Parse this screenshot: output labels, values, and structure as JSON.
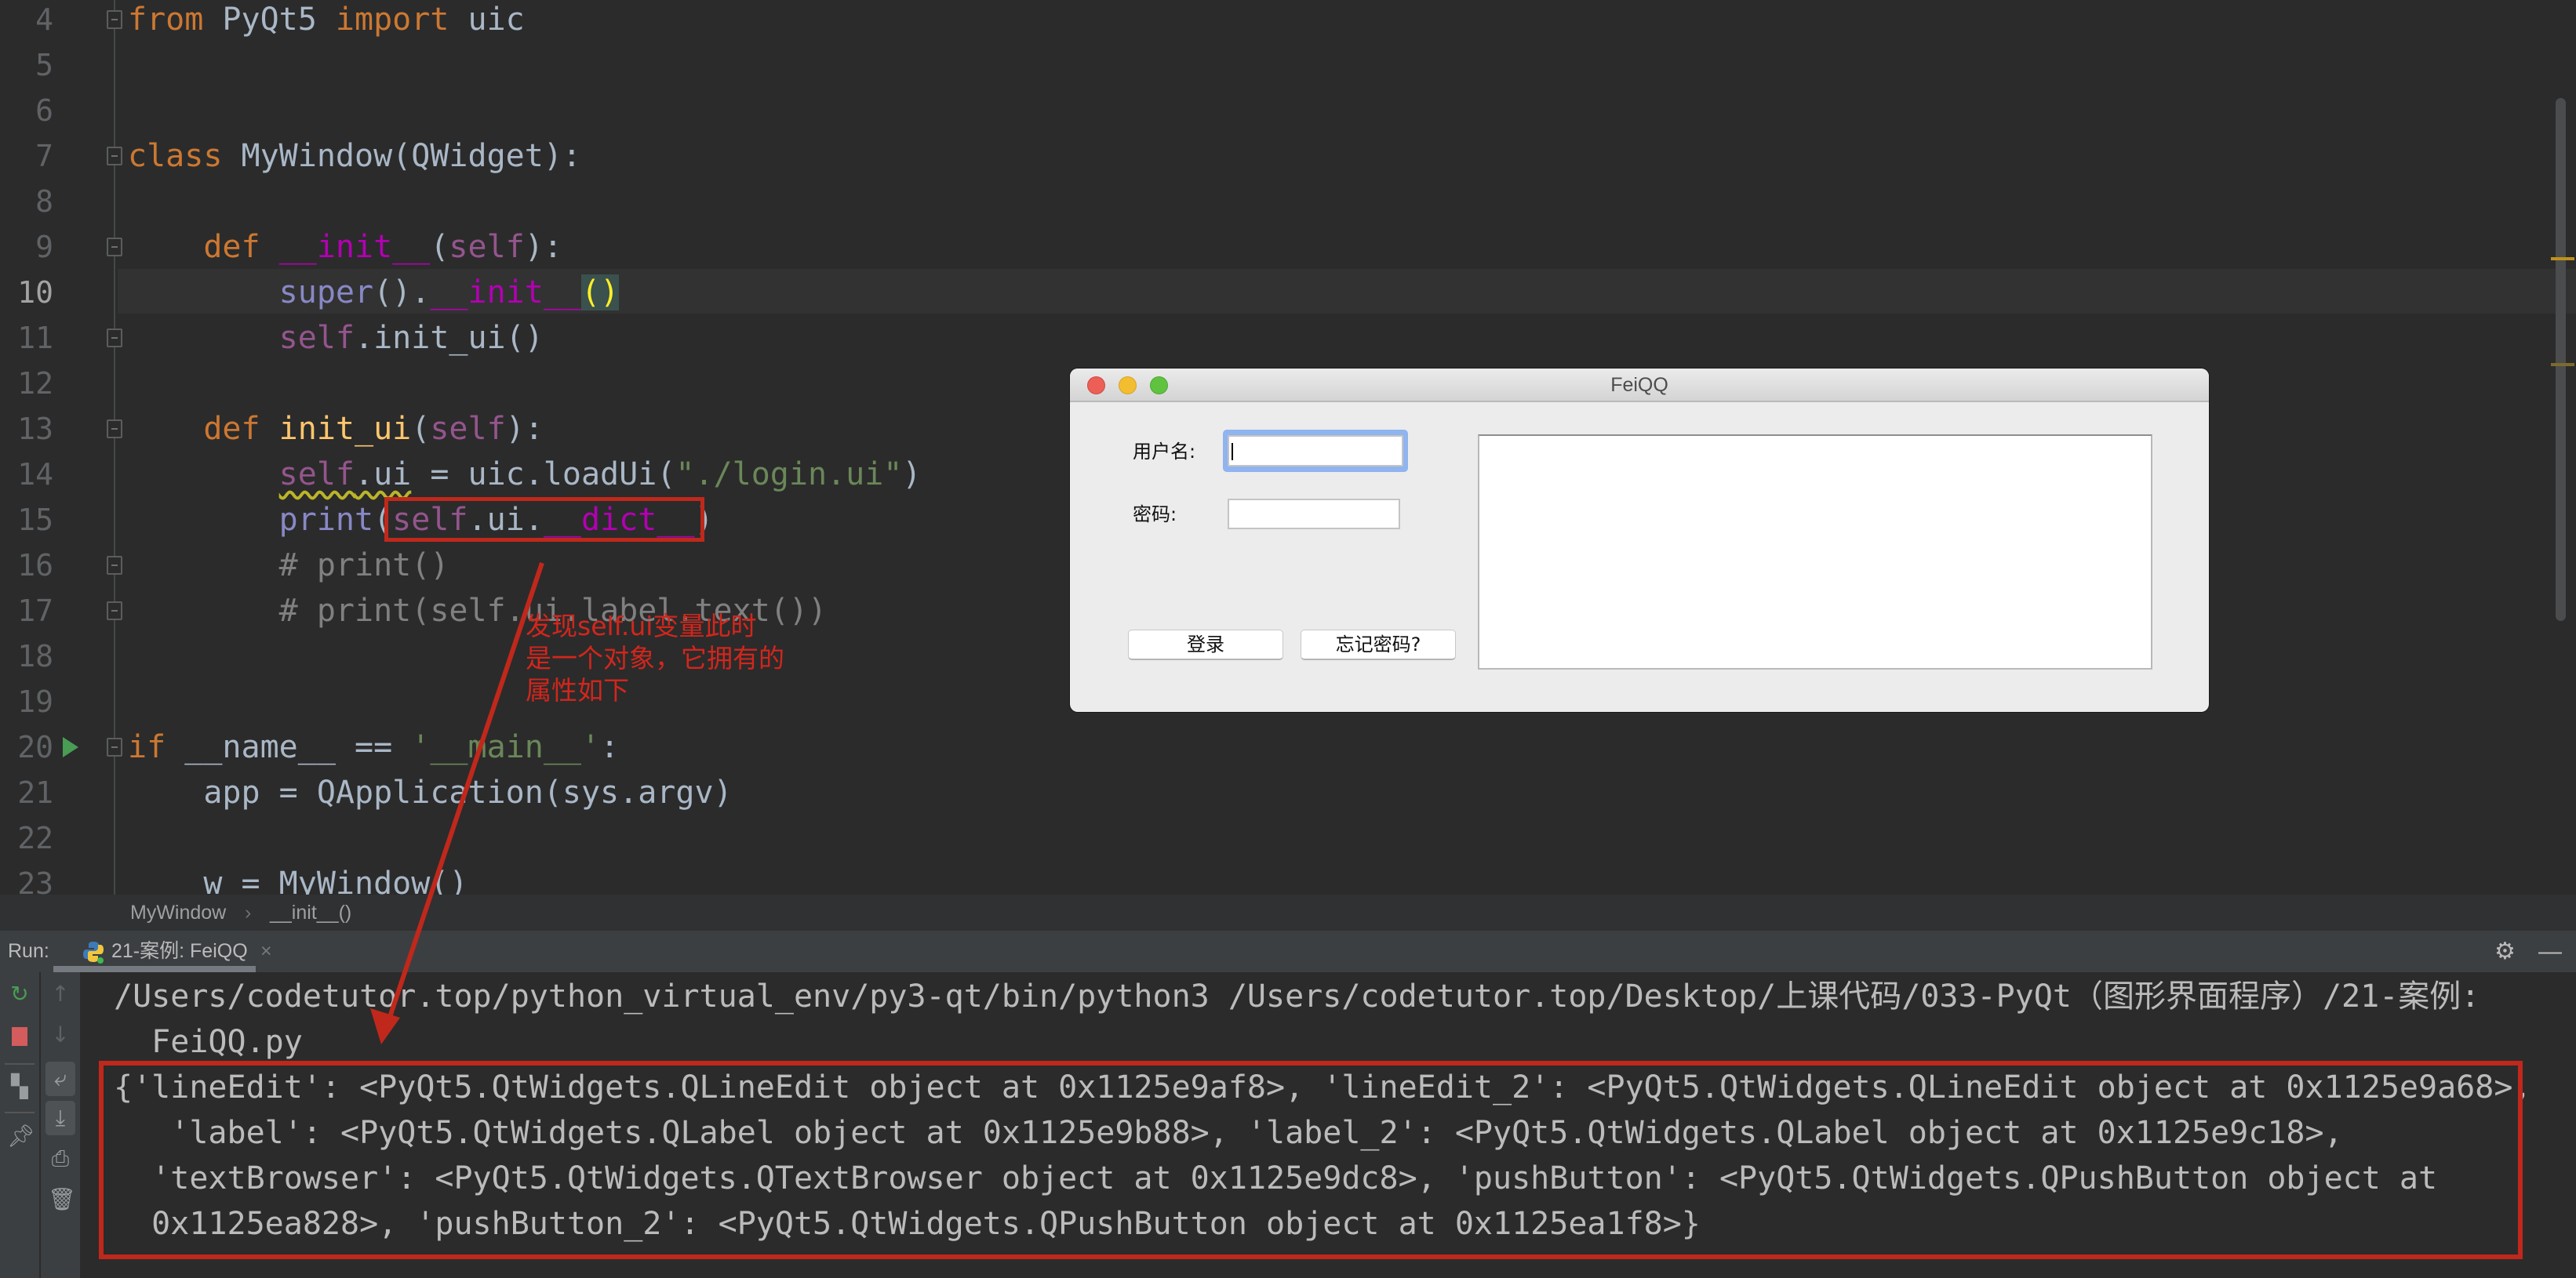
{
  "editor": {
    "current_line": 10,
    "lines": [
      {
        "num": "4",
        "fold": true,
        "tokens": [
          {
            "t": "from",
            "c": "kw"
          },
          {
            "t": " PyQt5 ",
            "c": "tx"
          },
          {
            "t": "import",
            "c": "kw"
          },
          {
            "t": " uic",
            "c": "tx"
          }
        ]
      },
      {
        "num": "5",
        "tokens": []
      },
      {
        "num": "6",
        "tokens": []
      },
      {
        "num": "7",
        "fold": true,
        "tokens": [
          {
            "t": "class",
            "c": "kw"
          },
          {
            "t": " MyWindow(QWidget):",
            "c": "tx"
          }
        ]
      },
      {
        "num": "8",
        "tokens": []
      },
      {
        "num": "9",
        "fold": true,
        "tokens": [
          {
            "t": "    ",
            "c": "tx"
          },
          {
            "t": "def",
            "c": "kw"
          },
          {
            "t": " ",
            "c": "tx"
          },
          {
            "t": "__init__",
            "c": "magic"
          },
          {
            "t": "(",
            "c": "tx"
          },
          {
            "t": "self",
            "c": "self"
          },
          {
            "t": "):",
            "c": "tx"
          }
        ]
      },
      {
        "num": "10",
        "tokens": [
          {
            "t": "        ",
            "c": "tx"
          },
          {
            "t": "super",
            "c": "bi"
          },
          {
            "t": "().",
            "c": "tx"
          },
          {
            "t": "__init__",
            "c": "magic"
          },
          {
            "t": "()",
            "c": "brace"
          }
        ]
      },
      {
        "num": "11",
        "fold": true,
        "tokens": [
          {
            "t": "        ",
            "c": "tx"
          },
          {
            "t": "self",
            "c": "self"
          },
          {
            "t": ".init_ui()",
            "c": "tx"
          }
        ]
      },
      {
        "num": "12",
        "tokens": []
      },
      {
        "num": "13",
        "fold": true,
        "tokens": [
          {
            "t": "    ",
            "c": "tx"
          },
          {
            "t": "def",
            "c": "kw"
          },
          {
            "t": " ",
            "c": "tx"
          },
          {
            "t": "init_ui",
            "c": "fn"
          },
          {
            "t": "(",
            "c": "tx"
          },
          {
            "t": "self",
            "c": "self"
          },
          {
            "t": "):",
            "c": "tx"
          }
        ]
      },
      {
        "num": "14",
        "tokens": [
          {
            "t": "        ",
            "c": "tx"
          },
          {
            "t": "self",
            "c": "self squig"
          },
          {
            "t": ".ui",
            "c": "tx squig"
          },
          {
            "t": " = uic.loadUi(",
            "c": "tx"
          },
          {
            "t": "\"./login.ui\"",
            "c": "str"
          },
          {
            "t": ")",
            "c": "tx"
          }
        ]
      },
      {
        "num": "15",
        "tokens": [
          {
            "t": "        ",
            "c": "tx"
          },
          {
            "t": "print",
            "c": "bi"
          },
          {
            "t": "(",
            "c": "tx"
          },
          {
            "t": "self",
            "c": "self"
          },
          {
            "t": ".ui.",
            "c": "tx"
          },
          {
            "t": "__dict__",
            "c": "magic"
          },
          {
            "t": ")",
            "c": "tx"
          }
        ]
      },
      {
        "num": "16",
        "fold": true,
        "tokens": [
          {
            "t": "        # print()",
            "c": "cm"
          }
        ]
      },
      {
        "num": "17",
        "fold": true,
        "tokens": [
          {
            "t": "        # print(self.ui.label.text())",
            "c": "cm"
          }
        ]
      },
      {
        "num": "18",
        "tokens": []
      },
      {
        "num": "19",
        "tokens": []
      },
      {
        "num": "20",
        "fold": true,
        "run": true,
        "tokens": [
          {
            "t": "if",
            "c": "kw"
          },
          {
            "t": " __name__ == ",
            "c": "tx"
          },
          {
            "t": "'__main__'",
            "c": "str"
          },
          {
            "t": ":",
            "c": "tx"
          }
        ]
      },
      {
        "num": "21",
        "tokens": [
          {
            "t": "    app = QApplication(sys.argv)",
            "c": "tx"
          }
        ]
      },
      {
        "num": "22",
        "tokens": []
      },
      {
        "num": "23",
        "tokens": [
          {
            "t": "    w = MyWindow()",
            "c": "tx"
          }
        ]
      }
    ]
  },
  "annotation": {
    "text": "发现self.ui变量此时\n是一个对象，它拥有的\n属性如下",
    "color": "#d2261c"
  },
  "breadcrumb": {
    "class_name": "MyWindow",
    "separator": "›",
    "method": "__init__()"
  },
  "run_panel": {
    "label": "Run:",
    "tab_label": "21-案例: FeiQQ",
    "tab_close": "×",
    "console_lines": [
      "/Users/codetutor.top/python_virtual_env/py3-qt/bin/python3 /Users/codetutor.top/Desktop/上课代码/033-PyQt（图形界面程序）/21-案例:",
      "  FeiQQ.py",
      "{'lineEdit': <PyQt5.QtWidgets.QLineEdit object at 0x1125e9af8>, 'lineEdit_2': <PyQt5.QtWidgets.QLineEdit object at 0x1125e9a68>,",
      "   'label': <PyQt5.QtWidgets.QLabel object at 0x1125e9b88>, 'label_2': <PyQt5.QtWidgets.QLabel object at 0x1125e9c18>,",
      "  'textBrowser': <PyQt5.QtWidgets.QTextBrowser object at 0x1125e9dc8>, 'pushButton': <PyQt5.QtWidgets.QPushButton object at",
      "  0x1125ea828>, 'pushButton_2': <PyQt5.QtWidgets.QPushButton object at 0x1125ea1f8>}"
    ]
  },
  "dialog": {
    "title": "FeiQQ",
    "username_label": "用户名:",
    "username_value": "",
    "password_label": "密码:",
    "password_value": "",
    "login_button": "登录",
    "forgot_button": "忘记密码?",
    "text_browser": ""
  },
  "colors": {
    "highlight_red": "#c0281b",
    "focus_ring": "#8fb4ef"
  }
}
